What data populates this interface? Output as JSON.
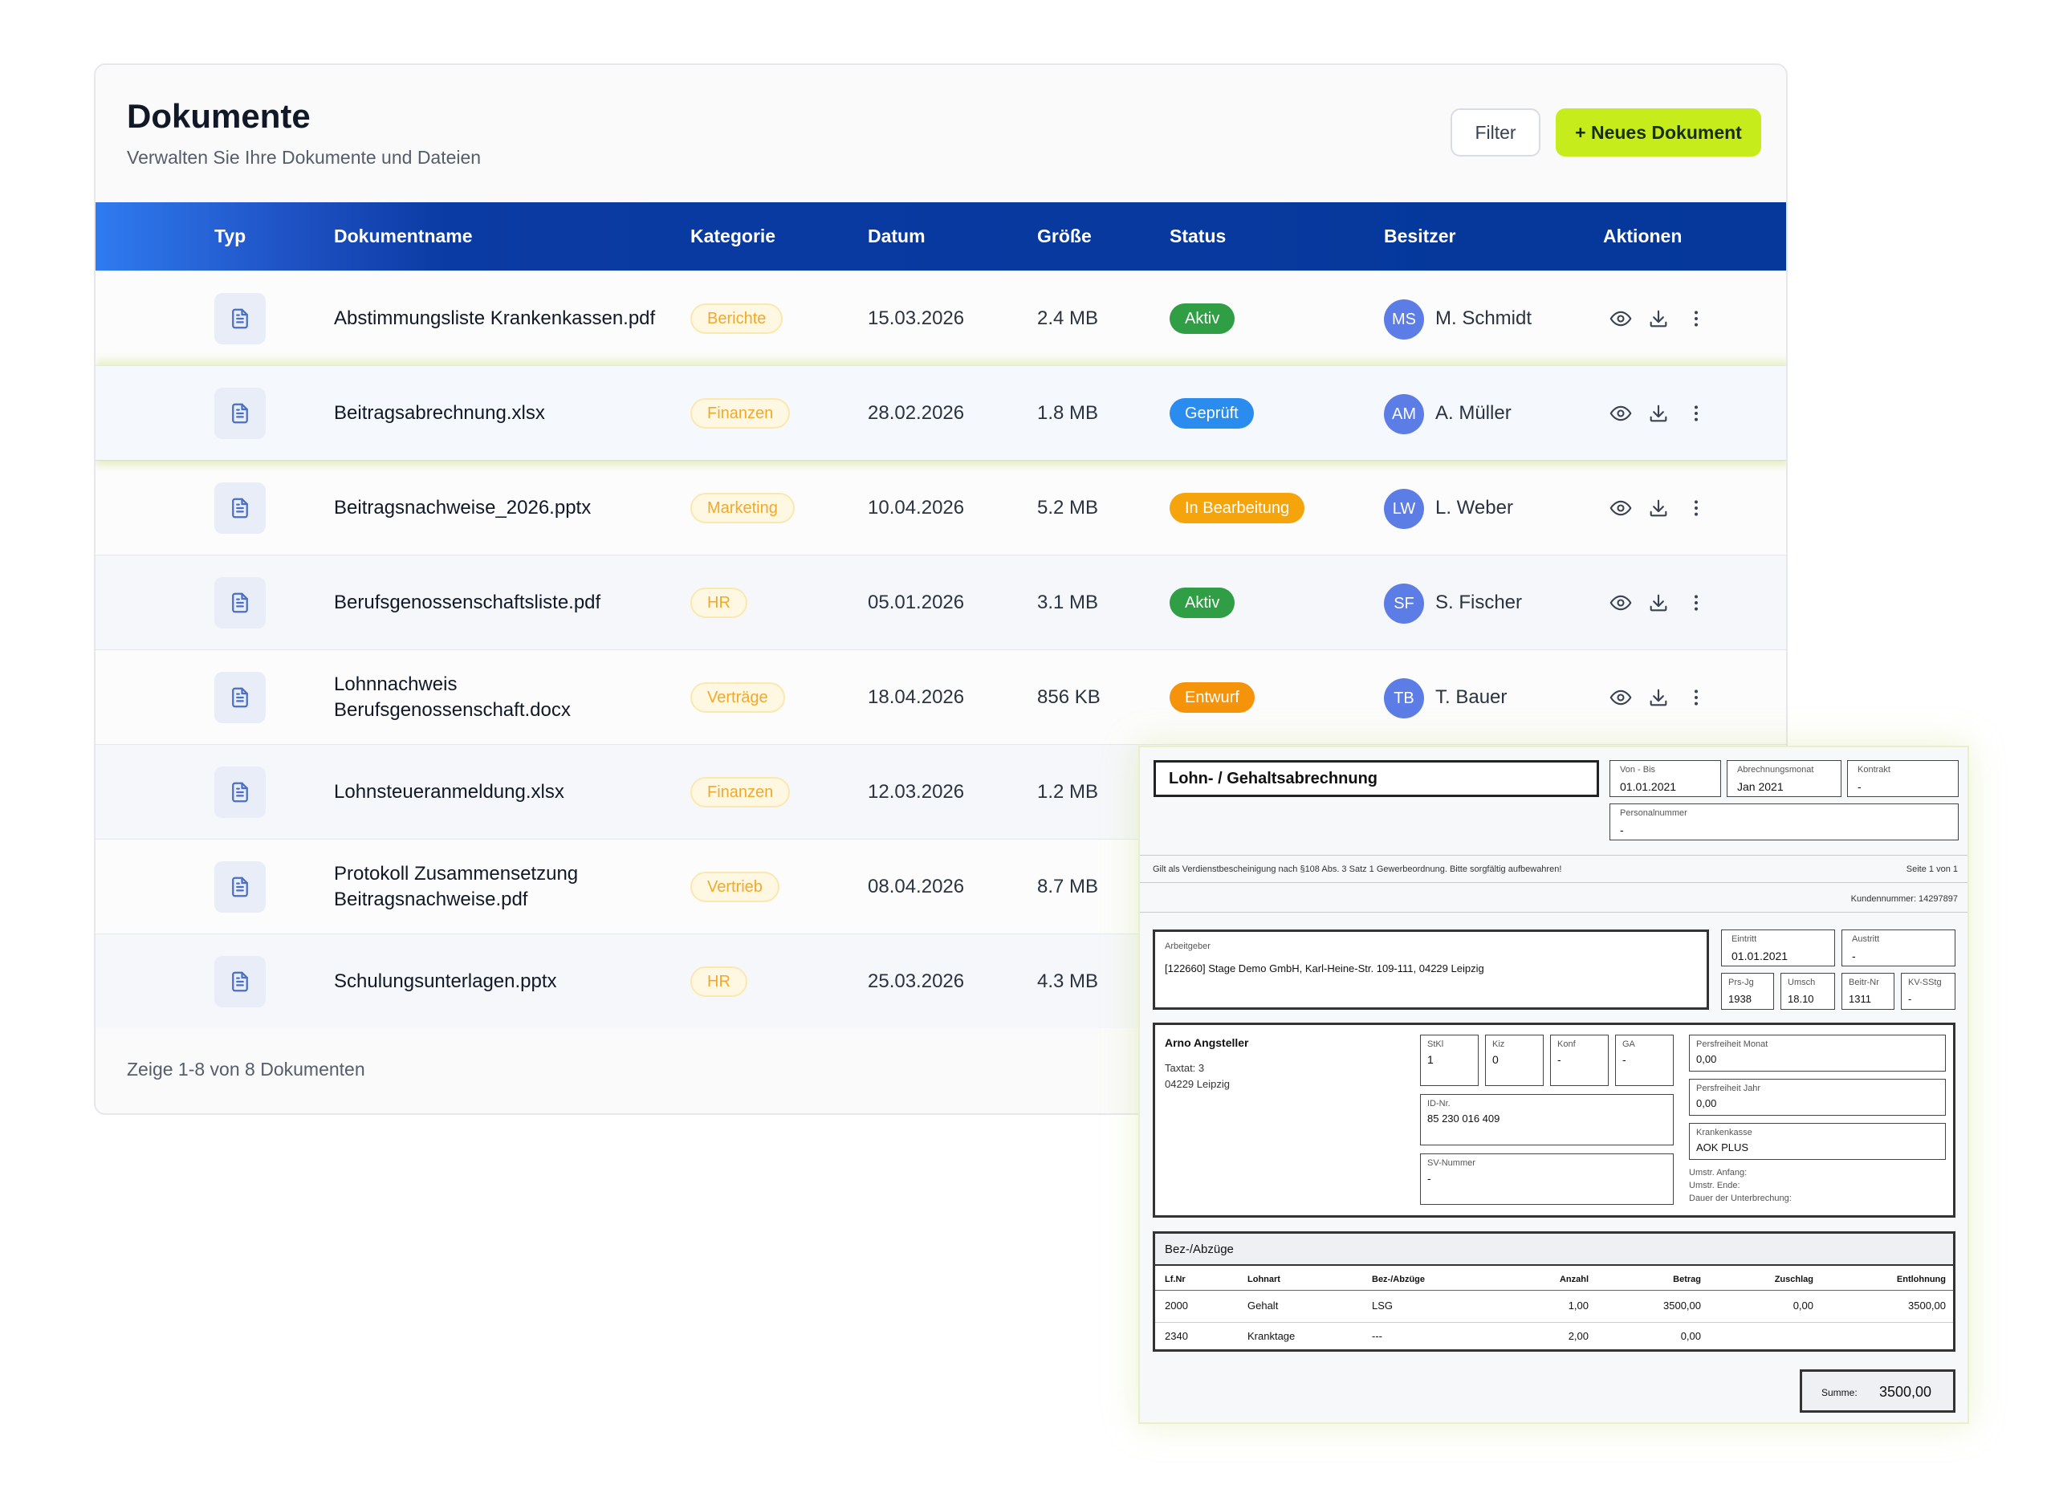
{
  "header": {
    "title": "Dokumente",
    "subtitle": "Verwalten Sie Ihre Dokumente und Dateien",
    "filter_label": "Filter",
    "new_label": "+ Neues Dokument"
  },
  "columns": {
    "type": "Typ",
    "name": "Dokumentname",
    "category": "Kategorie",
    "date": "Datum",
    "size": "Größe",
    "status": "Status",
    "owner": "Besitzer",
    "actions": "Aktionen"
  },
  "colors": {
    "accent_green": "#c6ec1c",
    "header_blue": "#05389a",
    "status_active": "#2f9e44",
    "status_checked": "#2b8cf0",
    "status_editing": "#f5a40b",
    "status_draft": "#f5930b",
    "category_text": "#f0a92b",
    "avatar": "#5c7ce6"
  },
  "rows": [
    {
      "name": "Abstimmungsliste Krankenkassen.pdf",
      "category": "Berichte",
      "date": "15.03.2026",
      "size": "2.4 MB",
      "status": "Aktiv",
      "initials": "MS",
      "owner": "M. Schmidt"
    },
    {
      "name": "Beitragsabrechnung.xlsx",
      "category": "Finanzen",
      "date": "28.02.2026",
      "size": "1.8 MB",
      "status": "Geprüft",
      "initials": "AM",
      "owner": "A. Müller"
    },
    {
      "name": "Beitragsnachweise_2026.pptx",
      "category": "Marketing",
      "date": "10.04.2026",
      "size": "5.2 MB",
      "status": "In Bearbeitung",
      "initials": "LW",
      "owner": "L. Weber"
    },
    {
      "name": "Berufsgenossenschaftsliste.pdf",
      "category": "HR",
      "date": "05.01.2026",
      "size": "3.1 MB",
      "status": "Aktiv",
      "initials": "SF",
      "owner": "S. Fischer"
    },
    {
      "name": "Lohnnachweis Berufsgenossenschaft.docx",
      "category": "Verträge",
      "date": "18.04.2026",
      "size": "856 KB",
      "status": "Entwurf",
      "initials": "TB",
      "owner": "T. Bauer"
    },
    {
      "name": "Lohnsteueranmeldung.xlsx",
      "category": "Finanzen",
      "date": "12.03.2026",
      "size": "1.2 MB"
    },
    {
      "name": "Protokoll Zusammensetzung Beitragsnachweise.pdf",
      "category": "Vertrieb",
      "date": "08.04.2026",
      "size": "8.7 MB"
    },
    {
      "name": "Schulungsunterlagen.pptx",
      "category": "HR",
      "date": "25.03.2026",
      "size": "4.3 MB"
    }
  ],
  "footer": {
    "text": "Zeige 1-8 von 8 Dokumenten"
  },
  "payslip": {
    "title": "Lohn- / Gehaltsabrechnung",
    "period_label": "Von - Bis",
    "period_value": "01.01.2021",
    "month_label": "Abrechnungsmonat",
    "month_value": "Jan 2021",
    "contract_label": "Kontrakt",
    "contract_value": "-",
    "personnel_label": "Personalnummer",
    "personnel_value": "-",
    "notice": "Gilt als Verdienstbescheinigung nach §108 Abs. 3 Satz 1 Gewerbeordnung. Bitte sorgfältig aufbewahren!",
    "page": "Seite 1 von 1",
    "customer_no": "Kundennummer: 14297897",
    "employer_label": "Arbeitgeber",
    "employer_value": "[122660] Stage Demo GmbH, Karl-Heine-Str. 109-111, 04229 Leipzig",
    "entry_label": "Eintritt",
    "entry_value": "01.01.2021",
    "exit_label": "Austritt",
    "exit_value": "-",
    "prsjg_label": "Prs-Jg",
    "prsjg_value": "1938",
    "umsch_label": "Umsch",
    "umsch_value": "18.10",
    "beitrnr_label": "Beitr-Nr",
    "beitrnr_value": "1311",
    "kvsstg_label": "KV-SStg",
    "kvsstg_value": "-",
    "employee_name": "Arno Angsteller",
    "employee_street": "Taxtat: 3",
    "employee_city": "04229 Leipzig",
    "stkl_label": "StKl",
    "stkl_value": "1",
    "kiz_label": "Kiz",
    "kiz_value": "0",
    "konf_label": "Konf",
    "konf_value": "-",
    "ga_label": "GA",
    "ga_value": "-",
    "idnr_label": "ID-Nr.",
    "idnr_value": "85 230 016 409",
    "svnr_label": "SV-Nummer",
    "svnr_value": "-",
    "pf_month_label": "Persfreiheit Monat",
    "pf_month_value": "0,00",
    "pf_year_label": "Persfreiheit Jahr",
    "pf_year_value": "0,00",
    "kk_label": "Krankenkasse",
    "kk_value": "AOK PLUS",
    "umstr_start": "Umstr. Anfang:",
    "umstr_end": "Umstr. Ende:",
    "interrupt": "Dauer der Unterbrechung:",
    "section_title": "Bez-/Abzüge",
    "table_headers": [
      "Lf.Nr",
      "Lohnart",
      "Bez-/Abzüge",
      "Anzahl",
      "Betrag",
      "Zuschlag",
      "Entlohnung"
    ],
    "table_rows": [
      [
        "2000",
        "Gehalt",
        "LSG",
        "1,00",
        "3500,00",
        "0,00",
        "3500,00"
      ],
      [
        "2340",
        "Kranktage",
        "---",
        "2,00",
        "0,00",
        "",
        ""
      ]
    ],
    "sum_label": "Summe:",
    "sum_value": "3500,00"
  }
}
